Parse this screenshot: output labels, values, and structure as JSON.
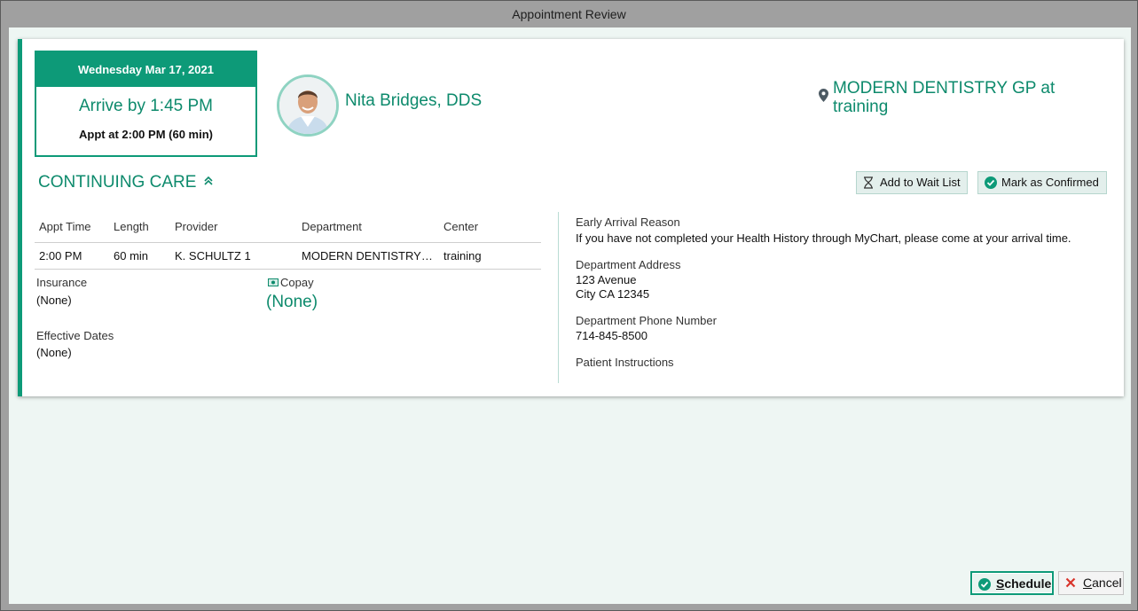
{
  "window": {
    "title": "Appointment Review"
  },
  "appointment": {
    "date": "Wednesday Mar 17, 2021",
    "arrive_by": "Arrive by 1:45 PM",
    "appt_at": "Appt at 2:00 PM (60 min)"
  },
  "provider": {
    "name": "Nita Bridges, DDS"
  },
  "location": {
    "line1": "MODERN DENTISTRY GP at",
    "line2": "training"
  },
  "section": {
    "title": "CONTINUING CARE"
  },
  "actions": {
    "wait_list": "Add to Wait List",
    "confirm": "Mark as Confirmed"
  },
  "table": {
    "headers": [
      "Appt Time",
      "Length",
      "Provider",
      "Department",
      "Center"
    ],
    "rows": [
      [
        "2:00 PM",
        "60 min",
        "K. SCHULTZ 1",
        "MODERN DENTISTRY…",
        "training"
      ]
    ]
  },
  "insurance": {
    "label": "Insurance",
    "value": "(None)",
    "copay_label": "Copay",
    "copay_value": "(None)",
    "effective_label": "Effective Dates",
    "effective_value": "(None)"
  },
  "details": {
    "early_arrival_label": "Early Arrival Reason",
    "early_arrival_value": "If you have not completed your Health History through MyChart, please come at your arrival time.",
    "address_label": "Department Address",
    "address_line1": "123 Avenue",
    "address_line2": "City CA 12345",
    "phone_label": "Department Phone Number",
    "phone_value": "714-845-8500",
    "instructions_label": "Patient Instructions"
  },
  "footer": {
    "schedule_first": "S",
    "schedule_rest": "chedule",
    "cancel_first": "C",
    "cancel_rest": "ancel"
  },
  "colors": {
    "accent": "#0d9a78",
    "accent_text": "#0d8a6c",
    "cancel_icon": "#d9342b"
  }
}
